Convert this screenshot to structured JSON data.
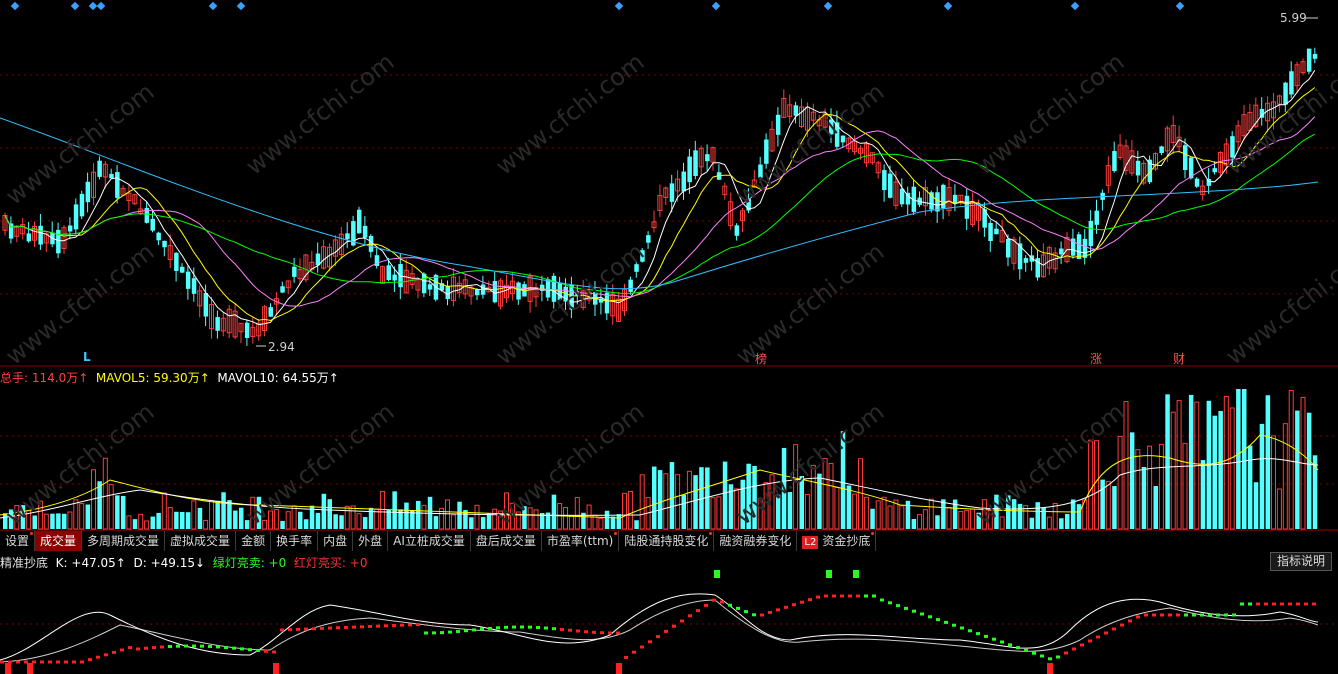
{
  "price_panel": {
    "high_label": "5.99",
    "low_label": "2.94",
    "markers": [
      {
        "text": "L",
        "color": "#3ec7ff"
      },
      {
        "text": "榜",
        "color": "#ff5050"
      },
      {
        "text": "涨",
        "color": "#ff5050"
      },
      {
        "text": "财",
        "color": "#ff5050"
      }
    ]
  },
  "volume_header": {
    "total": "总手: 114.0万↑",
    "mavol5": "MAVOL5: 59.30万↑",
    "mavol10": "MAVOL10: 64.55万↑"
  },
  "tabs": [
    {
      "label": "设置",
      "dot": true
    },
    {
      "label": "成交量",
      "active": true
    },
    {
      "label": "多周期成交量"
    },
    {
      "label": "虚拟成交量"
    },
    {
      "label": "金额"
    },
    {
      "label": "换手率"
    },
    {
      "label": "内盘"
    },
    {
      "label": "外盘"
    },
    {
      "label": "AI立桩成交量"
    },
    {
      "label": "盘后成交量"
    },
    {
      "label": "市盈率(ttm)",
      "dot": true
    },
    {
      "label": "陆股通持股变化",
      "dot": true
    },
    {
      "label": "融资融券变化"
    },
    {
      "label": "资金抄底",
      "badge": "L2",
      "dot": true
    }
  ],
  "indicator_header": {
    "name": "精准抄底",
    "k": "K: +47.05↑",
    "d": "D: +49.15↓",
    "green": "绿灯亮卖: +0",
    "red": "红灯亮买: +0"
  },
  "indicator_button": "指标说明",
  "watermark": "www.cfchi.com",
  "colors": {
    "up": "#ff3b3b",
    "down": "#54ffff",
    "ma5": "#ffffff",
    "ma10": "#ffff00",
    "ma20": "#ff80ff",
    "ma30": "#00ff00",
    "ma60": "#30c0ff",
    "grid": "#7a0000"
  }
}
